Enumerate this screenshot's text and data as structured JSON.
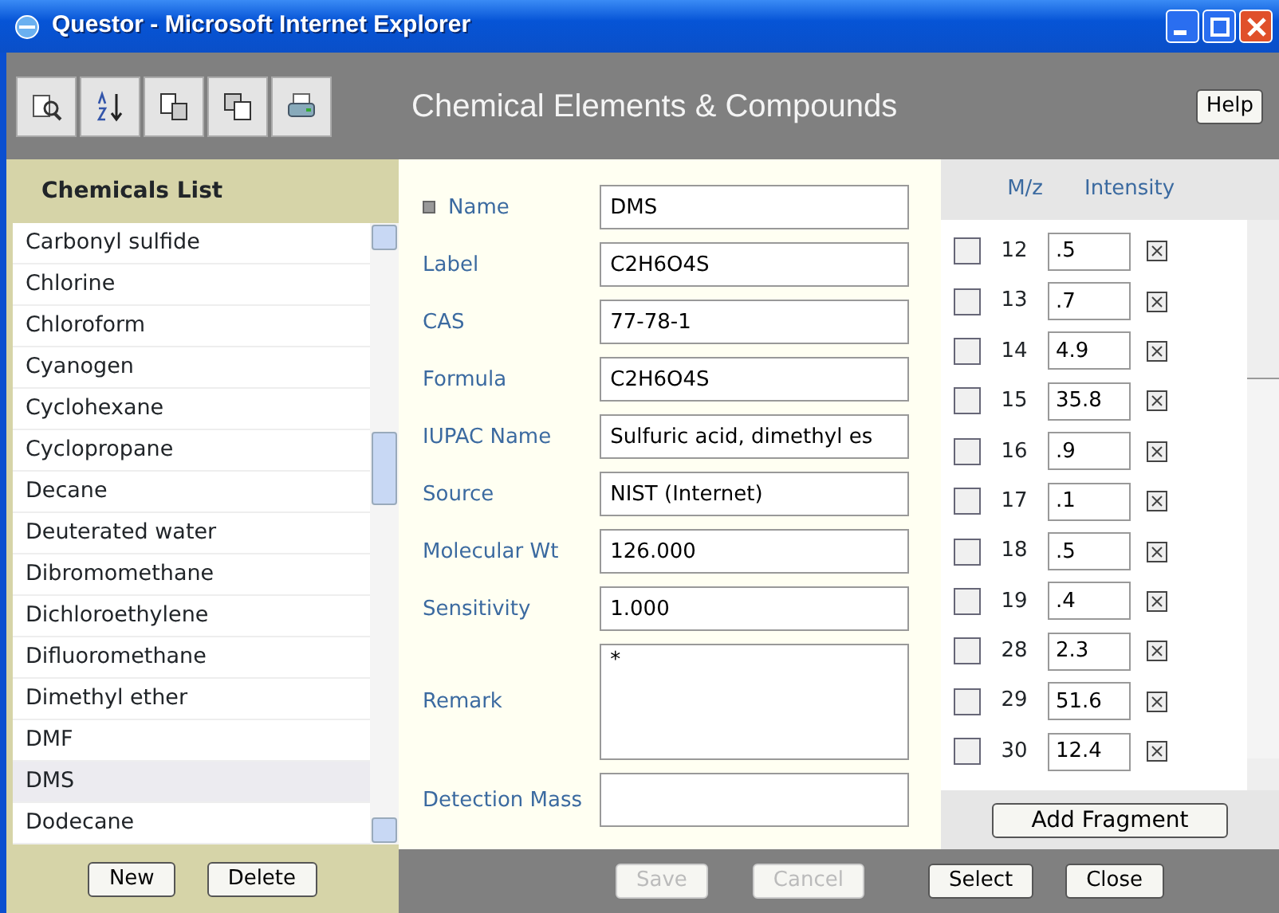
{
  "window": {
    "title": "Questor - Microsoft Internet Explorer"
  },
  "header": {
    "title": "Chemical Elements & Compounds",
    "help": "Help"
  },
  "chemicals_list": {
    "title": "Chemicals List",
    "items": [
      {
        "label": "Carbonyl sulfide",
        "selected": false
      },
      {
        "label": "Chlorine",
        "selected": false
      },
      {
        "label": "Chloroform",
        "selected": false
      },
      {
        "label": "Cyanogen",
        "selected": false
      },
      {
        "label": "Cyclohexane",
        "selected": false
      },
      {
        "label": "Cyclopropane",
        "selected": false
      },
      {
        "label": "Decane",
        "selected": false
      },
      {
        "label": "Deuterated water",
        "selected": false
      },
      {
        "label": "Dibromomethane",
        "selected": false
      },
      {
        "label": "Dichloroethylene",
        "selected": false
      },
      {
        "label": "Difluoromethane",
        "selected": false
      },
      {
        "label": "Dimethyl ether",
        "selected": false
      },
      {
        "label": "DMF",
        "selected": false
      },
      {
        "label": "DMS",
        "selected": true
      },
      {
        "label": "Dodecane",
        "selected": false
      }
    ],
    "buttons": [
      "New",
      "Delete"
    ]
  },
  "form": {
    "fields": [
      {
        "label": "Name",
        "value": "DMS",
        "kind": "input",
        "marked": true
      },
      {
        "label": "Label",
        "value": "C2H6O4S",
        "kind": "input",
        "marked": false
      },
      {
        "label": "CAS",
        "value": "77-78-1",
        "kind": "input",
        "marked": false
      },
      {
        "label": "Formula",
        "value": "C2H6O4S",
        "kind": "input",
        "marked": false
      },
      {
        "label": "IUPAC Name",
        "value": "Sulfuric acid, dimethyl es",
        "kind": "input",
        "marked": false
      },
      {
        "label": "Source",
        "value": "NIST (Internet)",
        "kind": "input",
        "marked": false
      },
      {
        "label": "Molecular Wt",
        "value": "126.000",
        "kind": "input",
        "marked": false
      },
      {
        "label": "Sensitivity",
        "value": "1.000",
        "kind": "input",
        "marked": false
      },
      {
        "label": "Remark",
        "value": "*",
        "kind": "textarea",
        "marked": false
      },
      {
        "label": "Detection Mass",
        "kind": "input",
        "marked": false
      }
    ]
  },
  "fragments": {
    "columns": [
      "M/z",
      "Intensity"
    ],
    "rows": [
      {
        "mz": "12",
        "intensity": ".5",
        "checked": false
      },
      {
        "mz": "13",
        "intensity": ".7",
        "checked": false
      },
      {
        "mz": "14",
        "intensity": "4.9",
        "checked": false
      },
      {
        "mz": "15",
        "intensity": "35.8",
        "checked": false
      },
      {
        "mz": "16",
        "intensity": ".9",
        "checked": false
      },
      {
        "mz": "17",
        "intensity": ".1",
        "checked": false
      },
      {
        "mz": "18",
        "intensity": ".5",
        "checked": false
      },
      {
        "mz": "19",
        "intensity": ".4",
        "checked": false
      },
      {
        "mz": "28",
        "intensity": "2.3",
        "checked": false
      },
      {
        "mz": "29",
        "intensity": "51.6",
        "checked": false
      },
      {
        "mz": "30",
        "intensity": "12.4",
        "checked": false
      }
    ],
    "add_button": "Add Fragment"
  },
  "actions": [
    {
      "label": "Save",
      "disabled": true
    },
    {
      "label": "Cancel",
      "disabled": true
    },
    {
      "label": "Select",
      "disabled": false
    },
    {
      "label": "Close",
      "disabled": false
    }
  ]
}
